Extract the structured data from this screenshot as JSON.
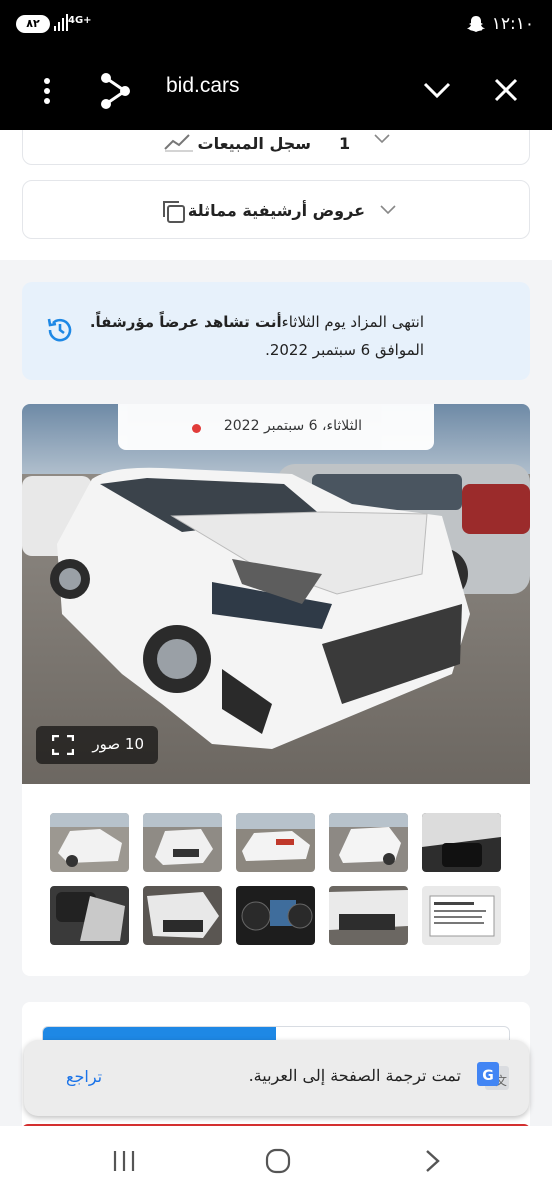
{
  "status": {
    "time": "١٢:١٠",
    "battery": "٨٢",
    "network": "4G+"
  },
  "browser": {
    "url": "bid.cars"
  },
  "rows": {
    "sales_history_label": "سجل المبيعات",
    "sales_history_count": "1",
    "archive_label": "عروض أرشيفية مماثلة"
  },
  "notice": {
    "line1_start": "انتهى المزاد يوم الثلاثاء",
    "line1_bold": "أنت تشاهد عرضاً مؤرشفاً.",
    "line2": "الموافق 6 سبتمبر 2022."
  },
  "gallery": {
    "date_label": "الثلاثاء، 6 سبتمبر 2022",
    "photos_count_label": "10 صور",
    "progress_fraction": 0.5
  },
  "translate": {
    "message": "تمت ترجمة الصفحة إلى العربية.",
    "undo_label": "تراجع"
  },
  "colors": {
    "accent": "#1e88e5",
    "notice_bg": "#e7f1fb",
    "live_dot": "#e53935"
  }
}
